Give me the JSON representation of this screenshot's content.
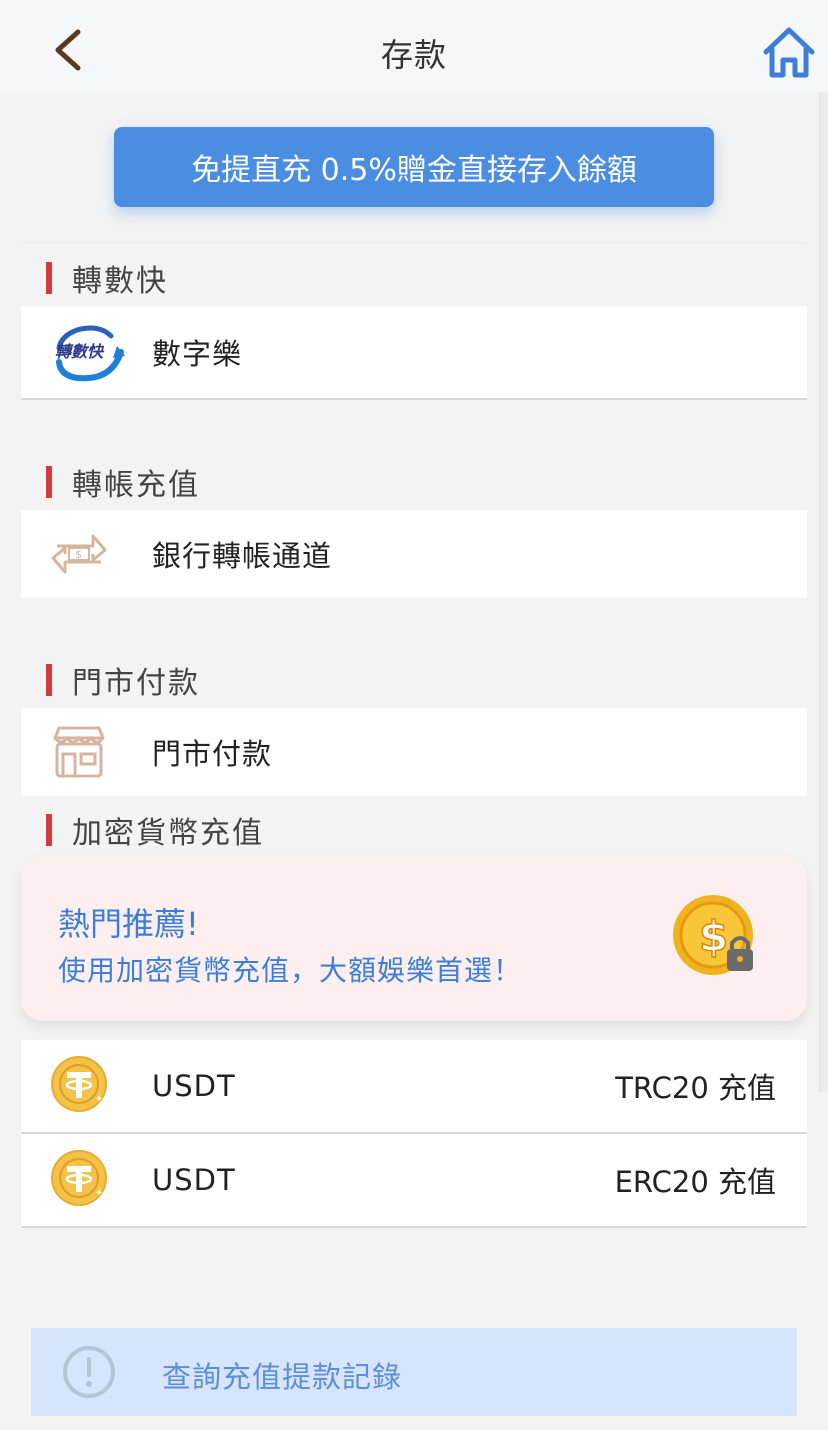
{
  "header": {
    "title": "存款"
  },
  "promo_button": {
    "label": "免提直充 0.5%贈金直接存入餘額"
  },
  "sections": [
    {
      "title": "轉數快",
      "items": [
        {
          "label": "數字樂",
          "logo_text": "轉數快",
          "icon": "fps-logo-icon"
        }
      ]
    },
    {
      "title": "轉帳充值",
      "items": [
        {
          "label": "銀行轉帳通道",
          "icon": "bank-transfer-icon"
        }
      ]
    },
    {
      "title": "門市付款",
      "items": [
        {
          "label": "門市付款",
          "icon": "storefront-icon"
        }
      ]
    },
    {
      "title": "加密貨幣充值",
      "items": [
        {
          "label": "USDT",
          "right": "TRC20 充值",
          "icon": "tether-coin-icon"
        },
        {
          "label": "USDT",
          "right": "ERC20 充值",
          "icon": "tether-coin-icon"
        }
      ]
    }
  ],
  "crypto_promo": {
    "headline": "熱門推薦!",
    "subtext": "使用加密貨幣充值，大額娛樂首選！",
    "icon": "dollar-coin-lock-icon"
  },
  "records_button": {
    "label": "查詢充值提款記錄",
    "icon": "exclamation-circle-icon"
  },
  "colors": {
    "accent_blue": "#4a8de1",
    "section_bar_red": "#d43a3a",
    "promo_text_blue": "#3d7ed9",
    "icon_brown": "#d6b59f"
  }
}
